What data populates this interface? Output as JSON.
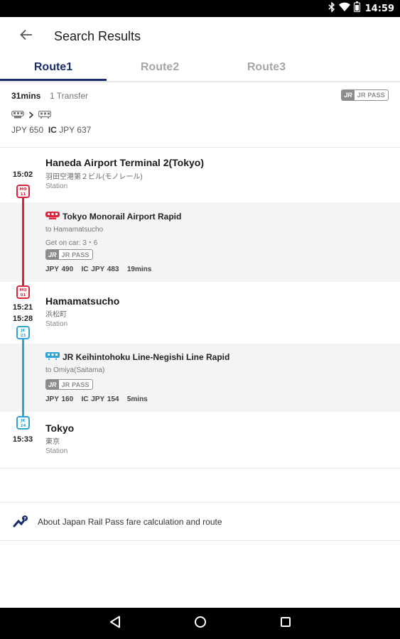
{
  "status_bar": {
    "time": "14:59",
    "icons": [
      "bluetooth-icon",
      "wifi-icon",
      "battery-icon"
    ]
  },
  "app_bar": {
    "title": "Search Results",
    "back_icon": "arrow-back-icon"
  },
  "tabs": [
    {
      "label": "Route1",
      "active": true
    },
    {
      "label": "Route2",
      "active": false
    },
    {
      "label": "Route3",
      "active": false
    }
  ],
  "summary": {
    "duration": "31mins",
    "transfers": "1 Transfer",
    "pass_badge": {
      "logo": "JR",
      "text": "JR PASS"
    },
    "modes": [
      "monorail-icon",
      "chevron-right-icon",
      "train-icon"
    ],
    "fare": "JPY 650",
    "ic_label": "IC",
    "ic_fare": "JPY 637"
  },
  "stops": [
    {
      "time": "15:02",
      "name": "Haneda Airport Terminal 2(Tokyo)",
      "name_jp": "羽田空港第２ビル(モノレール)",
      "type": "Station",
      "badge_line": "MO",
      "badge_no": "11"
    },
    {
      "arrive": "15:21",
      "depart": "15:28",
      "name": "Hamamatsucho",
      "name_jp": "浜松町",
      "type": "Station",
      "badge_in_line": "MO",
      "badge_in_no": "01",
      "badge_out_line": "JK",
      "badge_out_no": "23"
    },
    {
      "time": "15:33",
      "name": "Tokyo",
      "name_jp": "東京",
      "type": "Station",
      "badge_line": "JK",
      "badge_no": "24"
    }
  ],
  "segments": [
    {
      "name": "Tokyo Monorail Airport Rapid",
      "direction": "to Hamamatsucho",
      "car_info": "Get on car: 3・6",
      "pass_badge": {
        "logo": "JR",
        "text": "JR PASS"
      },
      "fare": "JPY 490",
      "ic_fare": "IC JPY 483",
      "duration": "19mins",
      "color": "#d8253a"
    },
    {
      "name": "JR Keihintohoku Line-Negishi Line Rapid",
      "direction": "to Omiya(Saitama)",
      "pass_badge": {
        "logo": "JR",
        "text": "JR PASS"
      },
      "fare": "JPY 160",
      "ic_fare": "IC JPY 154",
      "duration": "5mins",
      "color": "#2fa3d6"
    }
  ],
  "about": {
    "label": "About Japan Rail Pass fare calculation and route",
    "icon": "help-route-icon"
  },
  "nav_bar": {
    "buttons": [
      "back-triangle-icon",
      "home-circle-icon",
      "recents-square-icon"
    ]
  },
  "colors": {
    "accent": "#1b2c6e",
    "monorail": "#d8253a",
    "jr_line": "#2fa3d6",
    "pass_gray": "#8c8c8c"
  }
}
